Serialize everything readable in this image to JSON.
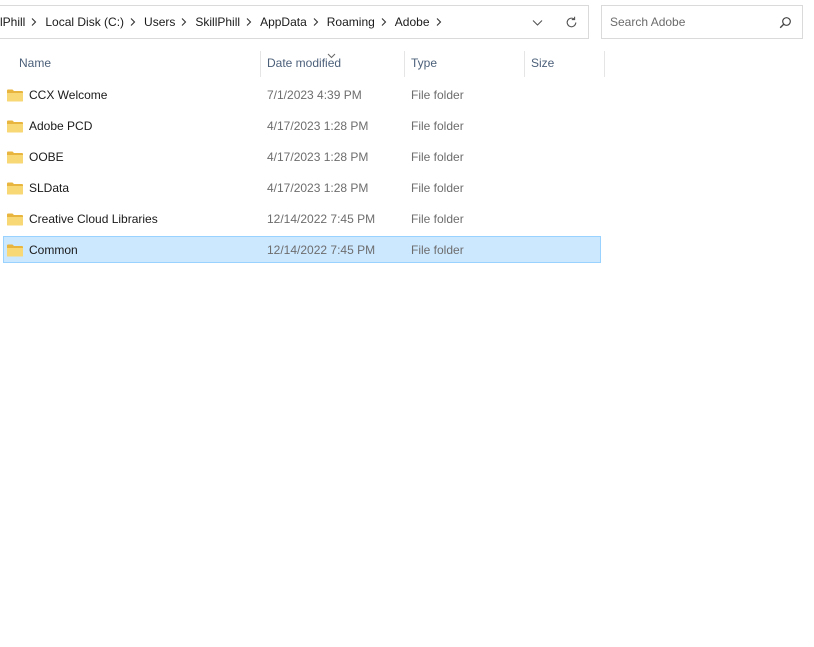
{
  "address": {
    "crumbs": [
      "lPhill",
      "Local Disk (C:)",
      "Users",
      "SkillPhill",
      "AppData",
      "Roaming",
      "Adobe"
    ]
  },
  "search": {
    "placeholder": "Search Adobe"
  },
  "columns": {
    "name": "Name",
    "date": "Date modified",
    "type": "Type",
    "size": "Size"
  },
  "files": [
    {
      "name": "CCX Welcome",
      "date": "7/1/2023 4:39 PM",
      "type": "File folder",
      "selected": false
    },
    {
      "name": "Adobe PCD",
      "date": "4/17/2023 1:28 PM",
      "type": "File folder",
      "selected": false
    },
    {
      "name": "OOBE",
      "date": "4/17/2023 1:28 PM",
      "type": "File folder",
      "selected": false
    },
    {
      "name": "SLData",
      "date": "4/17/2023 1:28 PM",
      "type": "File folder",
      "selected": false
    },
    {
      "name": "Creative Cloud Libraries",
      "date": "12/14/2022 7:45 PM",
      "type": "File folder",
      "selected": false
    },
    {
      "name": "Common",
      "date": "12/14/2022 7:45 PM",
      "type": "File folder",
      "selected": true
    }
  ],
  "colors": {
    "selected_bg": "#cce8ff",
    "selected_border": "#99d1ff",
    "folder_yellow": "#f8d775",
    "header_text": "#4c607a"
  },
  "icons": [
    "chevron-right-icon",
    "chevron-down-icon",
    "refresh-icon",
    "search-icon",
    "folder-icon",
    "sort-caret-icon"
  ]
}
